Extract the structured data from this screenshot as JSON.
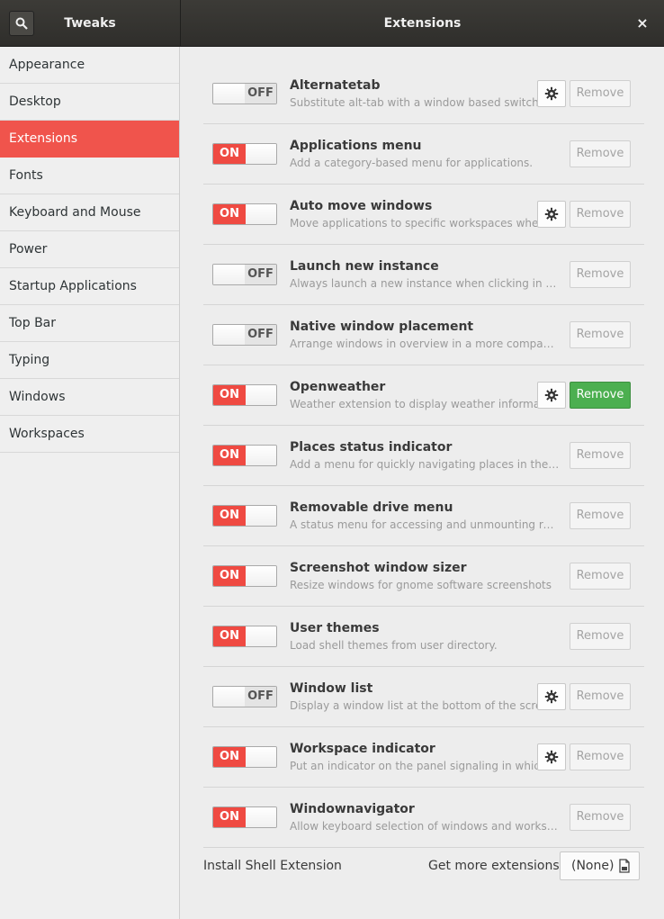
{
  "header": {
    "left_title": "Tweaks",
    "main_title": "Extensions",
    "close_glyph": "×"
  },
  "sidebar": {
    "items": [
      {
        "label": "Appearance",
        "active": false
      },
      {
        "label": "Desktop",
        "active": false
      },
      {
        "label": "Extensions",
        "active": true
      },
      {
        "label": "Fonts",
        "active": false
      },
      {
        "label": "Keyboard and Mouse",
        "active": false
      },
      {
        "label": "Power",
        "active": false
      },
      {
        "label": "Startup Applications",
        "active": false
      },
      {
        "label": "Top Bar",
        "active": false
      },
      {
        "label": "Typing",
        "active": false
      },
      {
        "label": "Windows",
        "active": false
      },
      {
        "label": "Workspaces",
        "active": false
      }
    ]
  },
  "extensions": [
    {
      "name": "Alternatetab",
      "desc": "Substitute alt-tab with a window based switch…",
      "state": "OFF",
      "has_settings": true,
      "remove_label": "Remove",
      "remove_active": false
    },
    {
      "name": "Applications menu",
      "desc": "Add a category-based menu for applications.",
      "state": "ON",
      "has_settings": false,
      "remove_label": "Remove",
      "remove_active": false
    },
    {
      "name": "Auto move windows",
      "desc": "Move applications to specific workspaces whe…",
      "state": "ON",
      "has_settings": true,
      "remove_label": "Remove",
      "remove_active": false
    },
    {
      "name": "Launch new instance",
      "desc": "Always launch a new instance when clicking in the da…",
      "state": "OFF",
      "has_settings": false,
      "remove_label": "Remove",
      "remove_active": false
    },
    {
      "name": "Native window placement",
      "desc": "Arrange windows in overview in a more compact way.",
      "state": "OFF",
      "has_settings": false,
      "remove_label": "Remove",
      "remove_active": false
    },
    {
      "name": "Openweather",
      "desc": "Weather extension to display weather informat…",
      "state": "ON",
      "has_settings": true,
      "remove_label": "Remove",
      "remove_active": true
    },
    {
      "name": "Places status indicator",
      "desc": "Add a menu for quickly navigating places in the system.",
      "state": "ON",
      "has_settings": false,
      "remove_label": "Remove",
      "remove_active": false
    },
    {
      "name": "Removable drive menu",
      "desc": "A status menu for accessing and unmounting remova…",
      "state": "ON",
      "has_settings": false,
      "remove_label": "Remove",
      "remove_active": false
    },
    {
      "name": "Screenshot window sizer",
      "desc": "Resize windows for gnome software screenshots",
      "state": "ON",
      "has_settings": false,
      "remove_label": "Remove",
      "remove_active": false
    },
    {
      "name": "User themes",
      "desc": "Load shell themes from user directory.",
      "state": "ON",
      "has_settings": false,
      "remove_label": "Remove",
      "remove_active": false
    },
    {
      "name": "Window list",
      "desc": "Display a window list at the bottom of the scre…",
      "state": "OFF",
      "has_settings": true,
      "remove_label": "Remove",
      "remove_active": false
    },
    {
      "name": "Workspace indicator",
      "desc": "Put an indicator on the panel signaling in whic…",
      "state": "ON",
      "has_settings": true,
      "remove_label": "Remove",
      "remove_active": false
    },
    {
      "name": "Windownavigator",
      "desc": "Allow keyboard selection of windows and workspace…",
      "state": "ON",
      "has_settings": false,
      "remove_label": "Remove",
      "remove_active": false
    }
  ],
  "footer": {
    "install_label": "Install Shell Extension",
    "get_more_label": "Get more extensions",
    "file_chooser_value": "(None)"
  },
  "colors": {
    "accent": "#f0544c",
    "remove_active": "#4caf50"
  }
}
